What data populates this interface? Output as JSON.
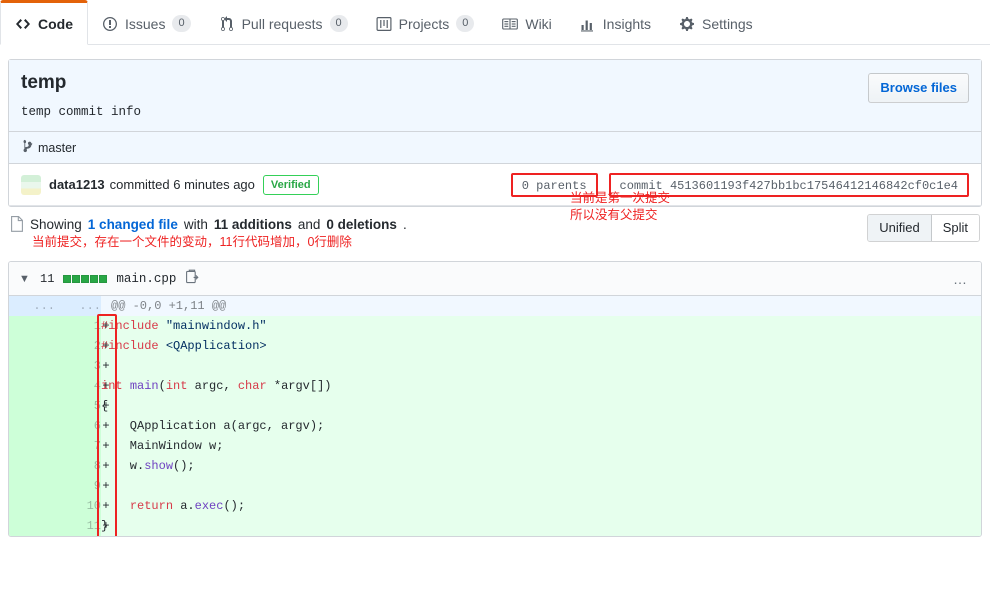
{
  "nav": {
    "tabs": [
      {
        "label": "Code",
        "icon": "code-icon",
        "count": null,
        "active": true
      },
      {
        "label": "Issues",
        "icon": "issue-opened-icon",
        "count": "0",
        "active": false
      },
      {
        "label": "Pull requests",
        "icon": "git-pull-request-icon",
        "count": "0",
        "active": false
      },
      {
        "label": "Projects",
        "icon": "project-icon",
        "count": "0",
        "active": false
      },
      {
        "label": "Wiki",
        "icon": "book-icon",
        "count": null,
        "active": false
      },
      {
        "label": "Insights",
        "icon": "graph-icon",
        "count": null,
        "active": false
      },
      {
        "label": "Settings",
        "icon": "gear-icon",
        "count": null,
        "active": false
      }
    ]
  },
  "commit": {
    "title": "temp",
    "description": "temp commit info",
    "browse_files_label": "Browse files",
    "branch": "master",
    "author": "data1213",
    "committed_text": "committed 6 minutes ago",
    "verified_label": "Verified",
    "parents_text": "0 parents",
    "sha_text": "commit 4513601193f427bb1bc17546412146842cf0c1e4"
  },
  "annotations": {
    "parents_note": "当前是第一次提交\n所以没有父提交",
    "showing_note": "当前提交，存在一个文件的变动，11行代码增加，0行删除"
  },
  "showing": {
    "prefix": "Showing",
    "changed_file": "1 changed file",
    "with": "with",
    "additions": "11 additions",
    "and": "and",
    "deletions": "0 deletions",
    "period": "."
  },
  "diff_toggle": {
    "unified": "Unified",
    "split": "Split",
    "selected": "Unified"
  },
  "file": {
    "changes_count": "11",
    "diffstat_blocks": 5,
    "name": "main.cpp",
    "copy_icon": "copy-path-icon",
    "kebab_icon": "kebab-horizontal-icon",
    "hunk_header": "@@ -0,0 +1,11 @@",
    "gutter_placeholder": "...",
    "lines": [
      {
        "n": "1",
        "marker": "+",
        "tokens": [
          {
            "t": "#include ",
            "c": "pp"
          },
          {
            "t": "\"mainwindow.h\"",
            "c": "s"
          }
        ]
      },
      {
        "n": "2",
        "marker": "+",
        "tokens": [
          {
            "t": "#include ",
            "c": "pp"
          },
          {
            "t": "<QApplication>",
            "c": "s"
          }
        ]
      },
      {
        "n": "3",
        "marker": "+",
        "tokens": []
      },
      {
        "n": "4",
        "marker": "+",
        "tokens": [
          {
            "t": "int",
            "c": "k"
          },
          {
            "t": " ",
            "c": "n"
          },
          {
            "t": "main",
            "c": "fn"
          },
          {
            "t": "(",
            "c": "n"
          },
          {
            "t": "int",
            "c": "k"
          },
          {
            "t": " argc, ",
            "c": "n"
          },
          {
            "t": "char",
            "c": "k"
          },
          {
            "t": " *argv[])",
            "c": "n"
          }
        ]
      },
      {
        "n": "5",
        "marker": "+",
        "tokens": [
          {
            "t": "{",
            "c": "n"
          }
        ]
      },
      {
        "n": "6",
        "marker": "+",
        "tokens": [
          {
            "t": "    QApplication a(argc, argv);",
            "c": "n"
          }
        ]
      },
      {
        "n": "7",
        "marker": "+",
        "tokens": [
          {
            "t": "    MainWindow w;",
            "c": "n"
          }
        ]
      },
      {
        "n": "8",
        "marker": "+",
        "tokens": [
          {
            "t": "    w.",
            "c": "n"
          },
          {
            "t": "show",
            "c": "fn"
          },
          {
            "t": "();",
            "c": "n"
          }
        ]
      },
      {
        "n": "9",
        "marker": "+",
        "tokens": []
      },
      {
        "n": "10",
        "marker": "+",
        "tokens": [
          {
            "t": "    ",
            "c": "n"
          },
          {
            "t": "return",
            "c": "k"
          },
          {
            "t": " a.",
            "c": "n"
          },
          {
            "t": "exec",
            "c": "fn"
          },
          {
            "t": "();",
            "c": "n"
          }
        ]
      },
      {
        "n": "11",
        "marker": "+",
        "tokens": [
          {
            "t": "}",
            "c": "n"
          }
        ]
      }
    ]
  },
  "colors": {
    "accent_orange": "#e36209",
    "link_blue": "#0366d6",
    "annotation_red": "#ee2222",
    "diff_add_bg": "#e6ffed",
    "diff_add_gutter": "#cdffd8",
    "header_blue": "#f1f8ff"
  }
}
